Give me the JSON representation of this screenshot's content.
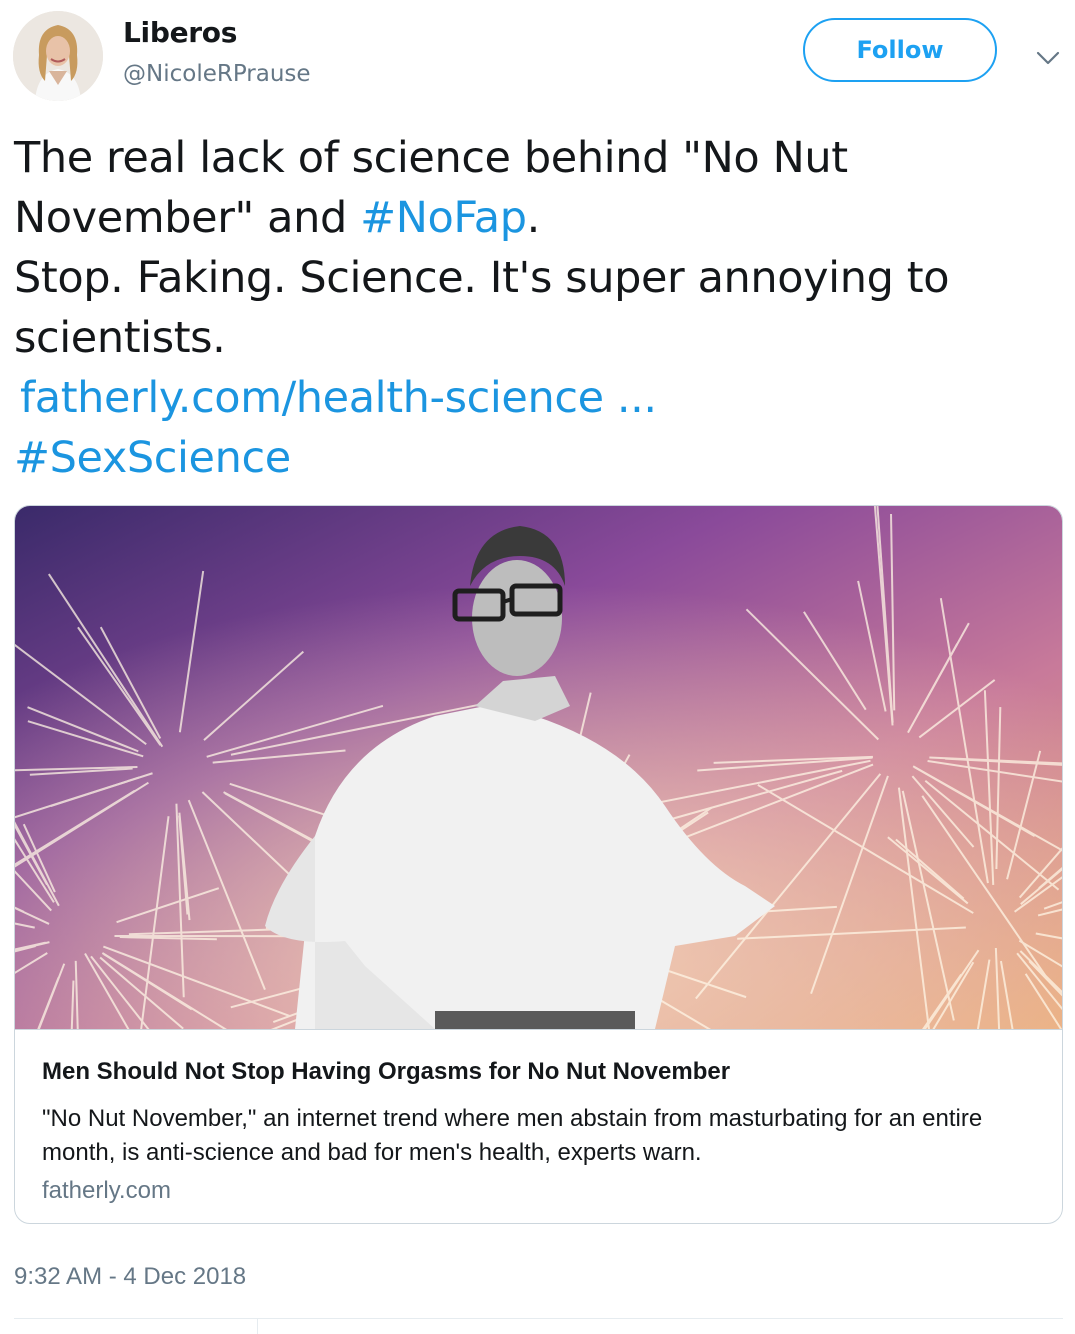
{
  "header": {
    "display_name": "Liberos",
    "handle": "@NicoleRPrause",
    "follow_label": "Follow"
  },
  "tweet": {
    "line1": "The real lack of science behind \"No Nut",
    "line2_text": "November\" and ",
    "line2_hashtag": "#NoFap",
    "line2_end": ".",
    "line3": "Stop. Faking. Science. It's super annoying to",
    "line4": "scientists.",
    "link": "fatherly.com/health-science ...",
    "hashtag2": "#SexScience"
  },
  "card": {
    "title": "Men Should Not Stop Having Orgasms for No Nut November",
    "description": "\"No Nut November,\" an internet trend where men abstain from masturbating for an entire month, is anti-science and bad for men's health, experts warn.",
    "domain": "fatherly.com"
  },
  "timestamp": "9:32 AM - 4 Dec 2018",
  "colors": {
    "link": "#1b95e0",
    "follow": "#1da1f2",
    "muted": "#657786",
    "border": "#ccd6dd"
  },
  "icons": {
    "caret": "chevron-down-icon"
  }
}
